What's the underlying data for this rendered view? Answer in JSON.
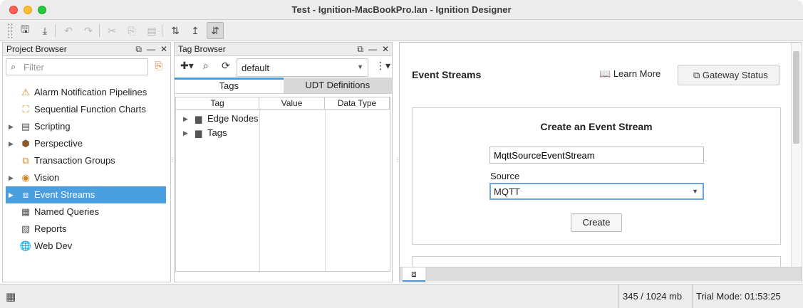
{
  "window": {
    "title": "Test - Ignition-MacBookPro.lan - Ignition Designer"
  },
  "toolbar": {
    "buttons": [
      {
        "name": "save-icon",
        "glyph": "🖫",
        "enabled": true
      },
      {
        "name": "save-publish-icon",
        "glyph": "⤓",
        "enabled": true
      },
      {
        "name": "undo-icon",
        "glyph": "↶",
        "enabled": false
      },
      {
        "name": "redo-icon",
        "glyph": "↷",
        "enabled": false
      },
      {
        "name": "cut-icon",
        "glyph": "✂",
        "enabled": false
      },
      {
        "name": "copy-icon",
        "glyph": "⎘",
        "enabled": false
      },
      {
        "name": "paste-icon",
        "glyph": "▤",
        "enabled": false
      },
      {
        "name": "comm-off-icon",
        "glyph": "⇅",
        "enabled": true
      },
      {
        "name": "comm-read-only-icon",
        "glyph": "↥",
        "enabled": true
      },
      {
        "name": "comm-read-write-icon",
        "glyph": "⇵",
        "enabled": true,
        "active": true
      }
    ]
  },
  "project_browser": {
    "title": "Project Browser",
    "filter_placeholder": "Filter",
    "items": [
      {
        "label": "Alarm Notification Pipelines",
        "icon": "alarm-pipeline-icon",
        "glyph": "⚠",
        "color": "#d6871b",
        "expandable": false
      },
      {
        "label": "Sequential Function Charts",
        "icon": "sfc-icon",
        "glyph": "⛶",
        "color": "#d6871b",
        "expandable": false
      },
      {
        "label": "Scripting",
        "icon": "scripting-icon",
        "glyph": "▤",
        "color": "#555555",
        "expandable": true
      },
      {
        "label": "Perspective",
        "icon": "perspective-icon",
        "glyph": "⬢",
        "color": "#8a5a2b",
        "expandable": true
      },
      {
        "label": "Transaction Groups",
        "icon": "transaction-groups-icon",
        "glyph": "⧉",
        "color": "#d6871b",
        "expandable": false
      },
      {
        "label": "Vision",
        "icon": "vision-icon",
        "glyph": "◉",
        "color": "#d6871b",
        "expandable": true
      },
      {
        "label": "Event Streams",
        "icon": "event-streams-icon",
        "glyph": "⧈",
        "color": "#ffffff",
        "expandable": true,
        "selected": true
      },
      {
        "label": "Named Queries",
        "icon": "named-queries-icon",
        "glyph": "▦",
        "color": "#555555",
        "expandable": false
      },
      {
        "label": "Reports",
        "icon": "reports-icon",
        "glyph": "▧",
        "color": "#555555",
        "expandable": false
      },
      {
        "label": "Web Dev",
        "icon": "web-dev-icon",
        "glyph": "🌐",
        "color": "#555555",
        "expandable": false
      }
    ]
  },
  "tag_browser": {
    "title": "Tag Browser",
    "provider": "default",
    "tabs": [
      {
        "label": "Tags",
        "active": true
      },
      {
        "label": "UDT Definitions",
        "active": false
      }
    ],
    "columns": [
      "Tag",
      "Value",
      "Data Type"
    ],
    "rows": [
      {
        "label": "Edge Nodes"
      },
      {
        "label": "Tags"
      }
    ]
  },
  "event_streams": {
    "header_title": "Event Streams",
    "learn_more": "Learn More",
    "gateway_status": "Gateway Status",
    "create_card": {
      "title": "Create an Event Stream",
      "name_value": "MqttSourceEventStream",
      "source_label": "Source",
      "source_value": "MQTT",
      "create_label": "Create"
    }
  },
  "status_bar": {
    "memory": "345 / 1024 mb",
    "trial": "Trial Mode: 01:53:25"
  },
  "colors": {
    "selection": "#4a9fe1",
    "accent_orange": "#d6871b"
  }
}
